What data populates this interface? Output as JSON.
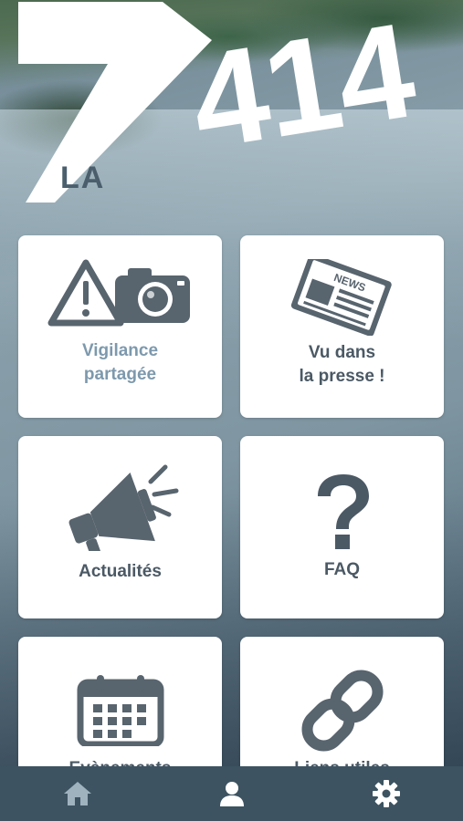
{
  "logo": {
    "prefix": "LA",
    "number": "414"
  },
  "tiles": [
    {
      "label": "Vigilance\npartagée",
      "icon": "warning-camera-icon"
    },
    {
      "label": "Vu dans\nla presse !",
      "icon": "newspaper-icon",
      "newspaper_text": "NEWS"
    },
    {
      "label": "Actualités",
      "icon": "megaphone-icon"
    },
    {
      "label": "FAQ",
      "icon": "question-mark-icon"
    },
    {
      "label": "Evènements",
      "icon": "calendar-icon"
    },
    {
      "label": "Liens utiles",
      "icon": "link-chain-icon"
    }
  ],
  "bottom_nav": [
    {
      "icon": "home-icon"
    },
    {
      "icon": "user-icon"
    },
    {
      "icon": "gear-icon"
    }
  ],
  "colors": {
    "icon_gray": "#58646e",
    "label_blue": "#7d99ad",
    "label_dark": "#4b5965",
    "nav_bg": "#3d5361"
  }
}
